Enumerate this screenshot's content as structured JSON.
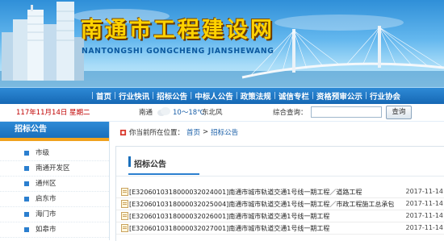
{
  "header": {
    "title": "南通市工程建设网",
    "subtitle": "NANTONGSHI GONGCHENG JIANSHEWANG"
  },
  "nav": {
    "items": [
      "首页",
      "行业快讯",
      "招标公告",
      "中标人公告",
      "政策法规",
      "诚信专栏",
      "资格预审公示",
      "行业协会"
    ]
  },
  "infobar": {
    "date": "117年11月14日 星期二",
    "city": "南通",
    "temperature": "10～18℃",
    "wind": "东北风",
    "search_label": "综合查询：",
    "search_value": "",
    "search_button": "查询"
  },
  "sidebar": {
    "title": "招标公告",
    "items": [
      "市级",
      "南通开发区",
      "通州区",
      "启东市",
      "海门市",
      "如皋市"
    ]
  },
  "breadcrumb": {
    "prefix": "你当前所在位置：",
    "home": "首页",
    "separator": ">",
    "current": "招标公告"
  },
  "main": {
    "section_title": "招标公告",
    "rows": [
      {
        "text": "[E3206010318000032024001]南通市城市轨道交通1号线一期工程／道路工程",
        "date": "2017-11-14"
      },
      {
        "text": "[E3206010318000032025004]南通市城市轨道交通1号线一期工程／市政工程施工总承包",
        "date": "2017-11-14"
      },
      {
        "text": "[E3206010318000032026001]南通市城市轨道交通1号线一期工程",
        "date": "2017-11-14"
      },
      {
        "text": "[E3206010318000032027001]南通市城市轨道交通1号线一期工程",
        "date": "2017-11-14"
      }
    ]
  },
  "colors": {
    "nav_blue": "#1a6fbb",
    "title_gold": "#ffd200",
    "date_red": "#c00000",
    "accent_orange": "#f0a21e"
  }
}
